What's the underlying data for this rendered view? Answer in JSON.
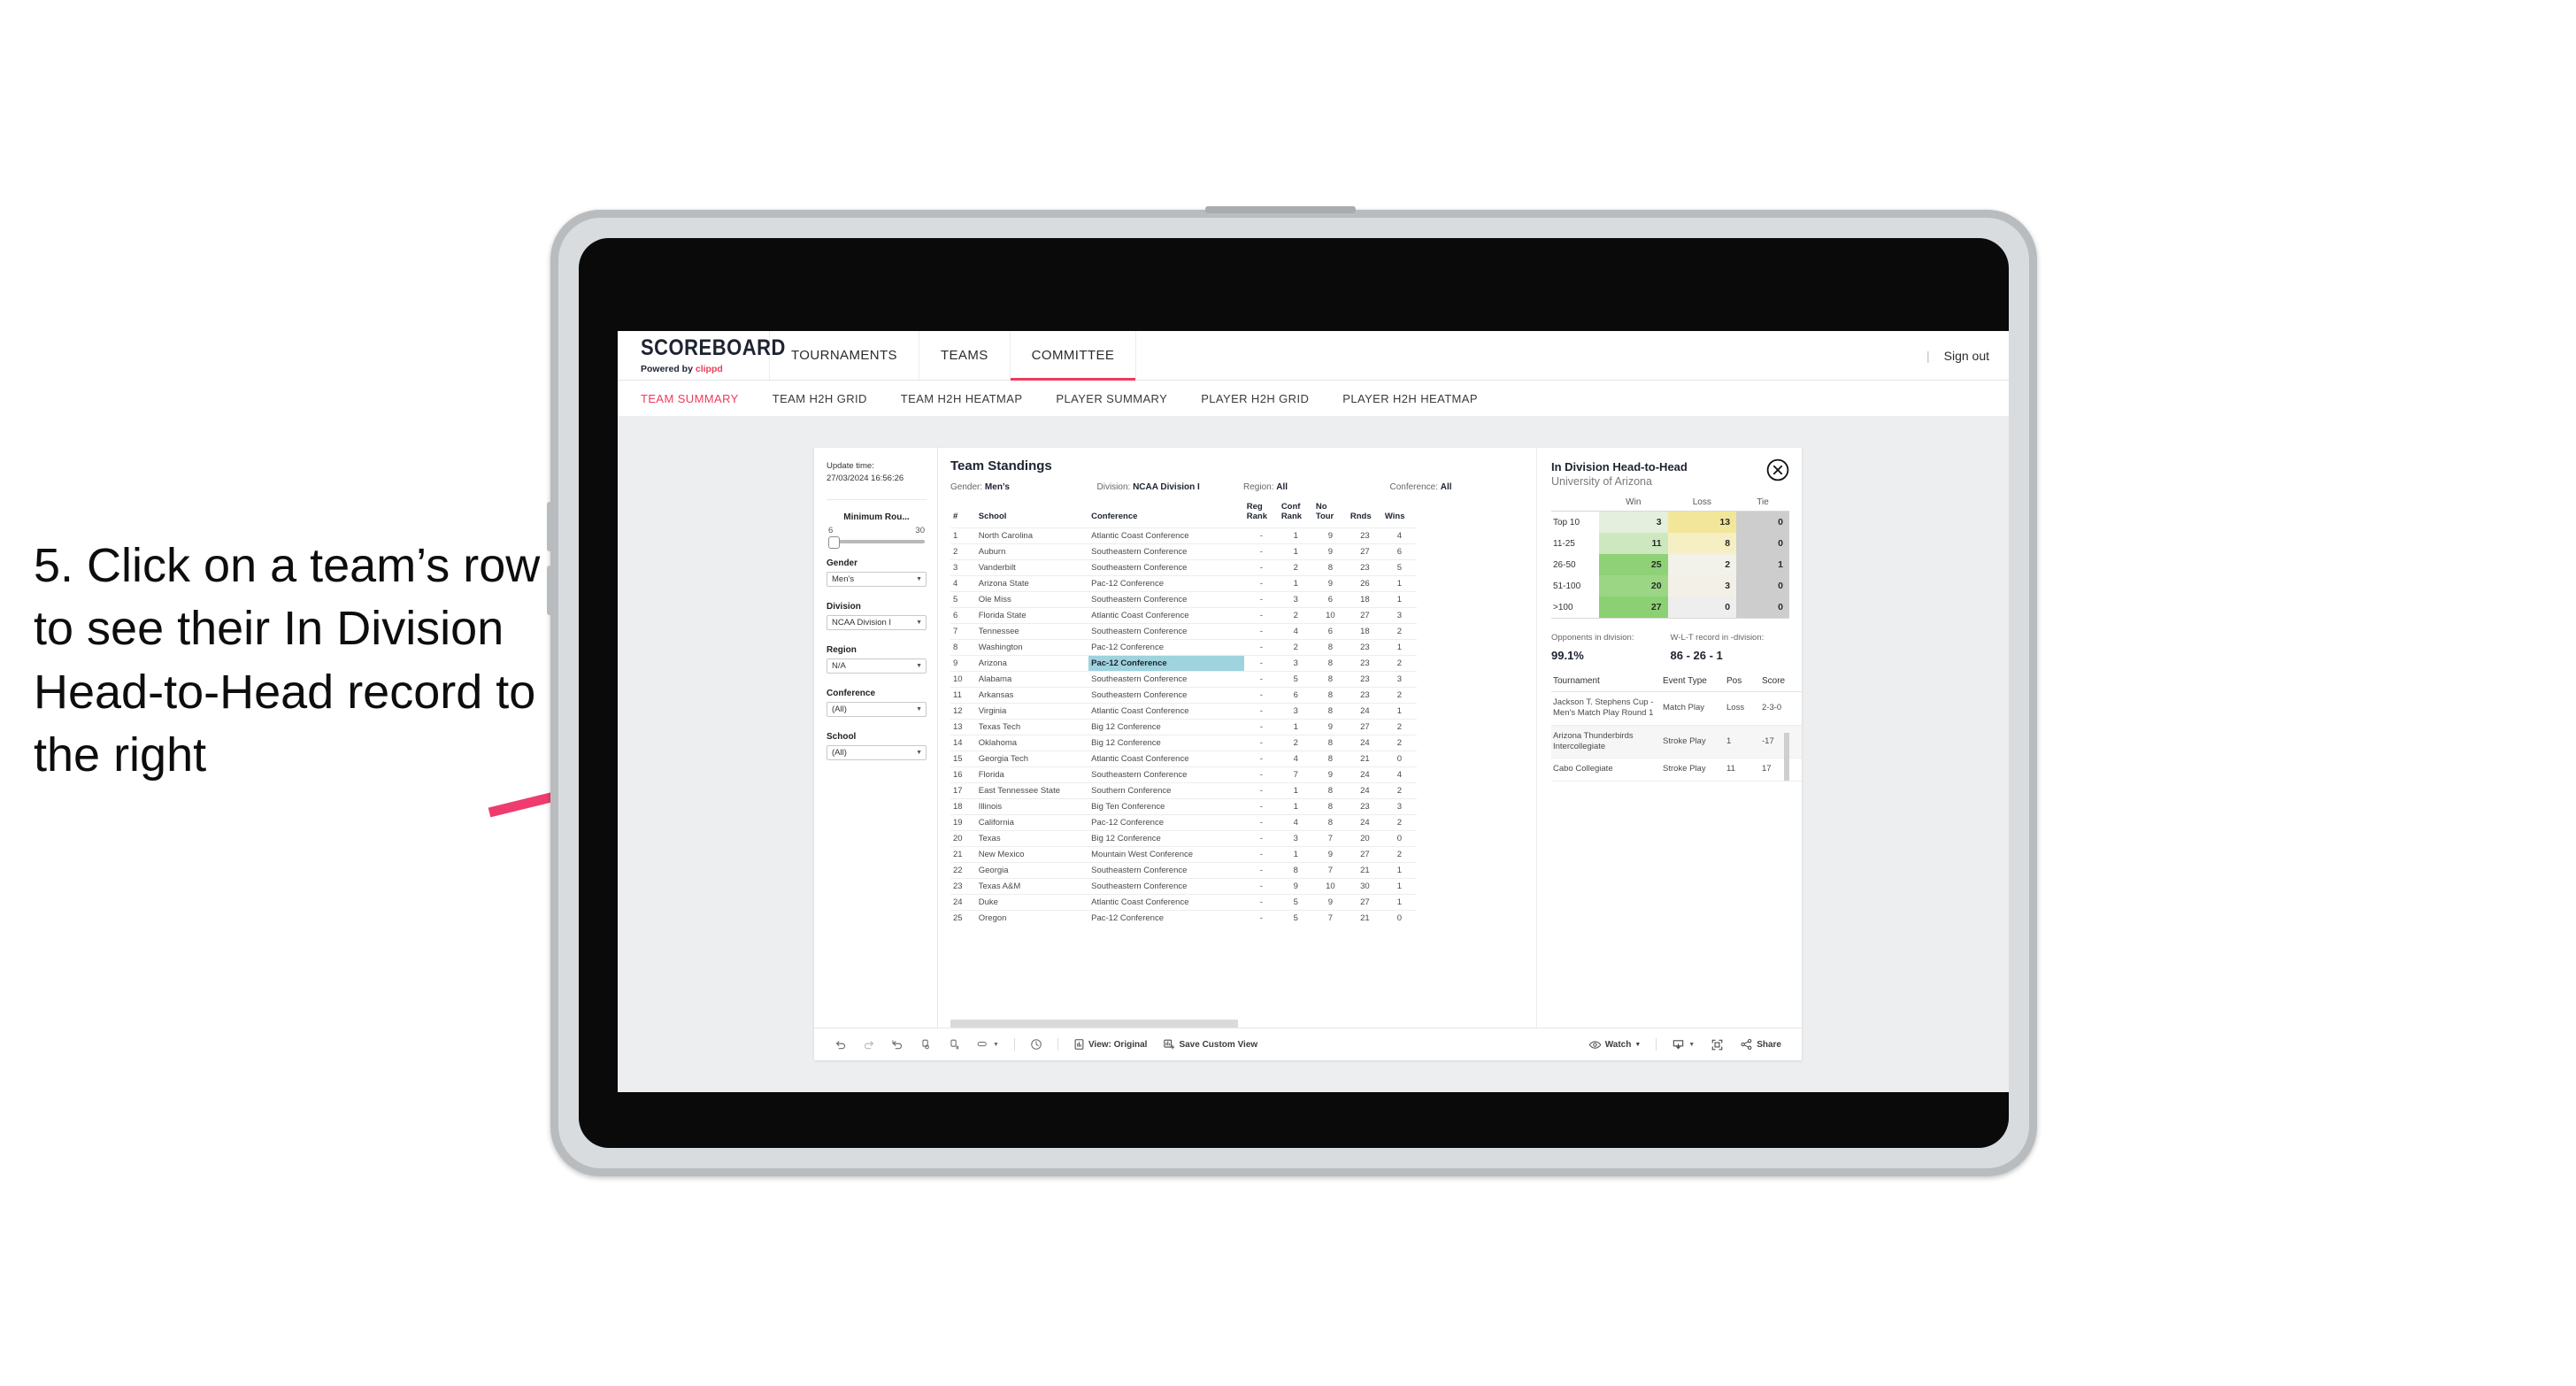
{
  "annotation": {
    "text": "5. Click on a team’s row to see their In Division Head-to-Head record to the right",
    "arrow_color": "#ef3b6e"
  },
  "app": {
    "brand": {
      "name": "SCOREBOARD",
      "powered_prefix": "Powered by ",
      "powered_name": "clippd"
    },
    "top_nav": [
      {
        "label": "TOURNAMENTS",
        "active": false
      },
      {
        "label": "TEAMS",
        "active": false
      },
      {
        "label": "COMMITTEE",
        "active": true
      }
    ],
    "sign_out": "Sign out",
    "sub_nav": [
      {
        "label": "TEAM SUMMARY",
        "active": true
      },
      {
        "label": "TEAM H2H GRID",
        "active": false
      },
      {
        "label": "TEAM H2H HEATMAP",
        "active": false
      },
      {
        "label": "PLAYER SUMMARY",
        "active": false
      },
      {
        "label": "PLAYER H2H GRID",
        "active": false
      },
      {
        "label": "PLAYER H2H HEATMAP",
        "active": false
      }
    ],
    "accent_color": "#ef3b5b"
  },
  "filters": {
    "update_time_label": "Update time:",
    "update_time_value": "27/03/2024 16:56:26",
    "slider": {
      "title": "Minimum Rou...",
      "min": "6",
      "max": "30"
    },
    "controls": [
      {
        "label": "Gender",
        "value": "Men’s"
      },
      {
        "label": "Division",
        "value": "NCAA Division I"
      },
      {
        "label": "Region",
        "value": "N/A"
      },
      {
        "label": "Conference",
        "value": "(All)"
      },
      {
        "label": "School",
        "value": "(All)"
      }
    ]
  },
  "standings": {
    "title": "Team Standings",
    "filter_summary": [
      {
        "label": "Gender:",
        "value": "Men’s"
      },
      {
        "label": "Division:",
        "value": "NCAA Division I"
      },
      {
        "label": "Region:",
        "value": "All"
      },
      {
        "label": "Conference:",
        "value": "All"
      }
    ],
    "columns": [
      "#",
      "School",
      "Conference",
      "Reg Rank",
      "Conf Rank",
      "No Tour",
      "Rnds",
      "Wins"
    ],
    "rows": [
      [
        "1",
        "North Carolina",
        "Atlantic Coast Conference",
        "-",
        "1",
        "9",
        "23",
        "4"
      ],
      [
        "2",
        "Auburn",
        "Southeastern Conference",
        "-",
        "1",
        "9",
        "27",
        "6"
      ],
      [
        "3",
        "Vanderbilt",
        "Southeastern Conference",
        "-",
        "2",
        "8",
        "23",
        "5"
      ],
      [
        "4",
        "Arizona State",
        "Pac-12 Conference",
        "-",
        "1",
        "9",
        "26",
        "1"
      ],
      [
        "5",
        "Ole Miss",
        "Southeastern Conference",
        "-",
        "3",
        "6",
        "18",
        "1"
      ],
      [
        "6",
        "Florida State",
        "Atlantic Coast Conference",
        "-",
        "2",
        "10",
        "27",
        "3"
      ],
      [
        "7",
        "Tennessee",
        "Southeastern Conference",
        "-",
        "4",
        "6",
        "18",
        "2"
      ],
      [
        "8",
        "Washington",
        "Pac-12 Conference",
        "-",
        "2",
        "8",
        "23",
        "1"
      ],
      [
        "9",
        "Arizona",
        "Pac-12 Conference",
        "-",
        "3",
        "8",
        "23",
        "2"
      ],
      [
        "10",
        "Alabama",
        "Southeastern Conference",
        "-",
        "5",
        "8",
        "23",
        "3"
      ],
      [
        "11",
        "Arkansas",
        "Southeastern Conference",
        "-",
        "6",
        "8",
        "23",
        "2"
      ],
      [
        "12",
        "Virginia",
        "Atlantic Coast Conference",
        "-",
        "3",
        "8",
        "24",
        "1"
      ],
      [
        "13",
        "Texas Tech",
        "Big 12 Conference",
        "-",
        "1",
        "9",
        "27",
        "2"
      ],
      [
        "14",
        "Oklahoma",
        "Big 12 Conference",
        "-",
        "2",
        "8",
        "24",
        "2"
      ],
      [
        "15",
        "Georgia Tech",
        "Atlantic Coast Conference",
        "-",
        "4",
        "8",
        "21",
        "0"
      ],
      [
        "16",
        "Florida",
        "Southeastern Conference",
        "-",
        "7",
        "9",
        "24",
        "4"
      ],
      [
        "17",
        "East Tennessee State",
        "Southern Conference",
        "-",
        "1",
        "8",
        "24",
        "2"
      ],
      [
        "18",
        "Illinois",
        "Big Ten Conference",
        "-",
        "1",
        "8",
        "23",
        "3"
      ],
      [
        "19",
        "California",
        "Pac-12 Conference",
        "-",
        "4",
        "8",
        "24",
        "2"
      ],
      [
        "20",
        "Texas",
        "Big 12 Conference",
        "-",
        "3",
        "7",
        "20",
        "0"
      ],
      [
        "21",
        "New Mexico",
        "Mountain West Conference",
        "-",
        "1",
        "9",
        "27",
        "2"
      ],
      [
        "22",
        "Georgia",
        "Southeastern Conference",
        "-",
        "8",
        "7",
        "21",
        "1"
      ],
      [
        "23",
        "Texas A&M",
        "Southeastern Conference",
        "-",
        "9",
        "10",
        "30",
        "1"
      ],
      [
        "24",
        "Duke",
        "Atlantic Coast Conference",
        "-",
        "5",
        "9",
        "27",
        "1"
      ],
      [
        "25",
        "Oregon",
        "Pac-12 Conference",
        "-",
        "5",
        "7",
        "21",
        "0"
      ]
    ],
    "selected_row_index": 8,
    "selected_cell_color": "#9fd3de"
  },
  "h2h": {
    "title": "In Division Head-to-Head",
    "subtitle": "University of Arizona",
    "close_icon": "close-circle-icon",
    "columns": [
      "",
      "Win",
      "Loss",
      "Tie"
    ],
    "rows": [
      {
        "label": "Top 10",
        "win": "3",
        "loss": "13",
        "tie": "0",
        "win_color": "#e4f0dd",
        "loss_color": "#f2e69a",
        "tie_color": "#cdcdcd"
      },
      {
        "label": "11-25",
        "win": "11",
        "loss": "8",
        "tie": "0",
        "win_color": "#cde8bf",
        "loss_color": "#f6efc4",
        "tie_color": "#cdcdcd"
      },
      {
        "label": "26-50",
        "win": "25",
        "loss": "2",
        "tie": "1",
        "win_color": "#8ed177",
        "loss_color": "#f2f1ea",
        "tie_color": "#cdcdcd"
      },
      {
        "label": "51-100",
        "win": "20",
        "loss": "3",
        "tie": "0",
        "win_color": "#9ad683",
        "loss_color": "#f3f0e7",
        "tie_color": "#cdcdcd"
      },
      {
        "label": ">100",
        "win": "27",
        "loss": "0",
        "tie": "0",
        "win_color": "#8bd072",
        "loss_color": "#eeeeee",
        "tie_color": "#cdcdcd"
      }
    ],
    "summary": [
      {
        "label": "Opponents in division:",
        "value": "99.1%"
      },
      {
        "label": "W-L-T record in -division:",
        "value": "86 - 26 - 1"
      }
    ],
    "events_columns": [
      "Tournament",
      "Event Type",
      "Pos",
      "Score"
    ],
    "events_rows": [
      [
        "Jackson T. Stephens Cup - Men’s Match Play Round 1",
        "Match Play",
        "Loss",
        "2-3-0"
      ],
      [
        "Arizona Thunderbirds Intercollegiate",
        "Stroke Play",
        "1",
        "-17"
      ],
      [
        "Cabo Collegiate",
        "Stroke Play",
        "11",
        "17"
      ]
    ]
  },
  "toolbar": {
    "left_icons": [
      "undo-icon",
      "redo-icon",
      "revert-icon",
      "refresh-data-icon",
      "pause-updates-icon",
      "highlight-icon",
      "chevron-down-icon"
    ],
    "clock_icon": "clock-icon",
    "view_label": "View: Original",
    "view_icon": "view-original-icon",
    "save_label": "Save Custom View",
    "save_icon": "save-view-icon",
    "watch_label": "Watch",
    "watch_icon": "eye-icon",
    "download_icon": "download-icon",
    "fullscreen_icon": "fullscreen-icon",
    "share_label": "Share",
    "share_icon": "share-icon"
  }
}
